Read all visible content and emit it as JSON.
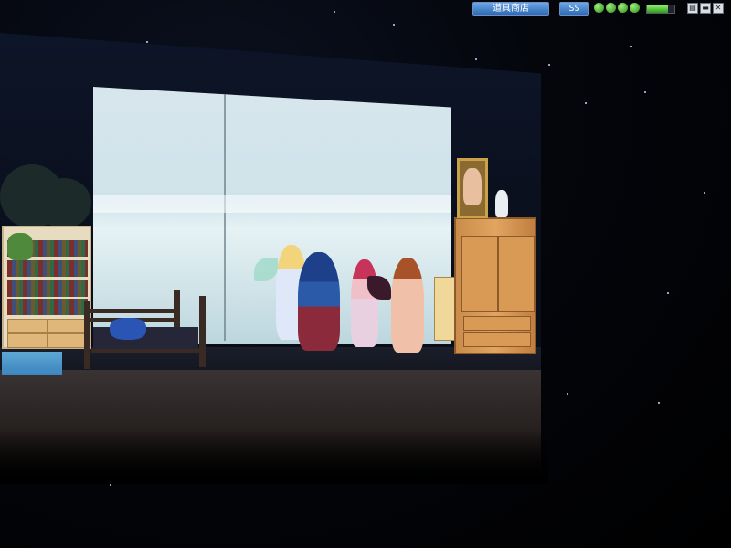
{
  "hud": {
    "shop_label": "道具商店",
    "ss_label": "SS",
    "status_orbs": [
      "orb-icon",
      "orb-icon",
      "orb-icon",
      "orb-icon"
    ],
    "gauge_level": 0.75,
    "window_controls": [
      {
        "name": "menu-icon",
        "glyph": "▤"
      },
      {
        "name": "minimize-icon",
        "glyph": "▬"
      },
      {
        "name": "close-icon",
        "glyph": "✕"
      }
    ]
  },
  "colors": {
    "hud_button": "#3f7fcc",
    "orb": "#4fc02f",
    "window_glow": "#d7e6ec",
    "wardrobe": "#e2a560"
  }
}
